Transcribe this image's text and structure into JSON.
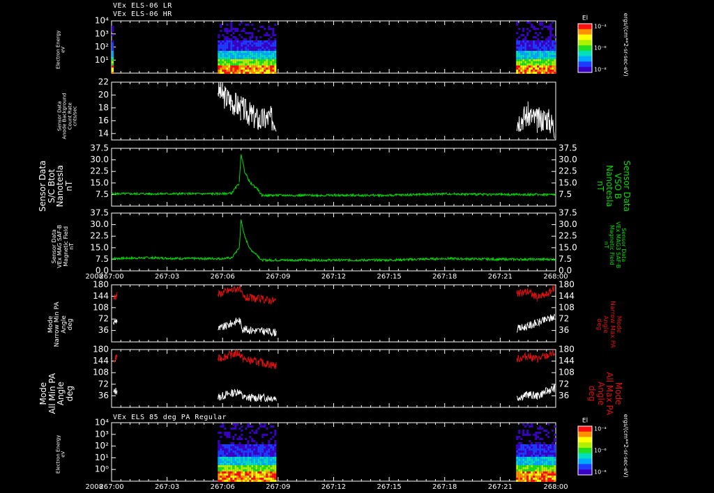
{
  "headers": {
    "top_line1": "VEx ELS-06 LR",
    "top_line2": "VEx ELS-06 HR",
    "bottom_line": "VEx ELS 85 deg PA Regular"
  },
  "colors": {
    "background": "#000000",
    "axis": "#ffffff",
    "trace_white": "#ffffff",
    "trace_green": "#00dd00",
    "trace_red": "#dd1111",
    "label_green": "#00dd00",
    "label_red": "#dd1111"
  },
  "colorbar": {
    "title": "El",
    "unit_label": "ergs/(cm**2-sr-sec-eV)",
    "tick_labels": [
      "10⁻⁴",
      "10⁻⁶",
      "10⁻⁸"
    ]
  },
  "time_axis": {
    "year_label": "2008",
    "tick_labels": [
      "267:00",
      "267:03",
      "267:06",
      "267:09",
      "267:12",
      "267:15",
      "267:18",
      "267:21",
      "268:00"
    ]
  },
  "panels": [
    {
      "id": "spectro1",
      "ylabel": [
        "Electron Energy",
        "eV"
      ],
      "ytick_labels": [
        "10⁴",
        "10³",
        "10²",
        "10¹"
      ]
    },
    {
      "id": "anode",
      "ylabel": [
        "Sensor Data",
        "Anode Background",
        "Count Rate",
        "cnts/sec"
      ],
      "ytick_labels": [
        "22",
        "20",
        "18",
        "16",
        "14"
      ]
    },
    {
      "id": "btot",
      "ylabel": [
        "Sensor Data",
        "S/C Btot",
        "Nanotesla",
        "nT"
      ],
      "ylabel_right": [
        "Sensor Data",
        "VSO B",
        "Nanotesla",
        "nT"
      ],
      "ytick_labels": [
        "37.5",
        "30.0",
        "22.5",
        "15.0",
        "7.5"
      ]
    },
    {
      "id": "mag",
      "ylabel": [
        "Sensor Data",
        "VEx MAG SAF-B",
        "Magnetic Field",
        "nT"
      ],
      "ylabel_right": [
        "Sensor Data",
        "VEx MAG3 SAF-B",
        "Magnetic Field",
        "nT"
      ],
      "ytick_labels": [
        "37.5",
        "30.0",
        "22.5",
        "15.0",
        "7.5",
        "0.0"
      ]
    },
    {
      "id": "pa_narrow",
      "ylabel": [
        "Mode",
        "Narrow Min PA",
        "Angle",
        "deg"
      ],
      "ylabel_right": [
        "Mode",
        "Narrow Max PA",
        "Angle",
        "deg"
      ],
      "ytick_labels": [
        "180",
        "144",
        "108",
        "72",
        "36"
      ]
    },
    {
      "id": "pa_all",
      "ylabel": [
        "Mode",
        "All Min PA",
        "Angle",
        "deg"
      ],
      "ylabel_right": [
        "Mode",
        "All Max PA",
        "Angle",
        "deg"
      ],
      "ytick_labels": [
        "180",
        "144",
        "108",
        "72",
        "36"
      ]
    },
    {
      "id": "spectro2",
      "ylabel": [
        "Electron Energy",
        "eV"
      ],
      "ytick_labels": [
        "10⁴",
        "10³",
        "10²",
        "10¹",
        "10⁰"
      ]
    }
  ],
  "chart_data": [
    {
      "type": "heatmap",
      "panel": "spectro1",
      "y_axis": "Electron Energy (eV)",
      "y_scale": "log",
      "ylim": [
        1,
        10000
      ],
      "data_intervals_hours": [
        [
          0.0,
          0.06
        ],
        [
          5.74,
          8.9
        ],
        [
          21.86,
          24.0
        ]
      ]
    },
    {
      "type": "line",
      "panel": "anode",
      "y_axis": "Anode Background Count Rate (cnts/sec)",
      "ylim": [
        13,
        22
      ],
      "series": [
        {
          "color": "#ffffff",
          "x_hours": [
            0.02,
            5.75,
            6.0,
            6.5,
            7.0,
            7.5,
            8.0,
            8.5,
            8.9,
            21.9,
            22.5,
            23.0,
            23.5,
            23.95
          ],
          "values": [
            16,
            21,
            20,
            19,
            18,
            17,
            16,
            16.5,
            16,
            16,
            17,
            16,
            16.5,
            15
          ]
        }
      ]
    },
    {
      "type": "line",
      "panel": "btot",
      "y_axis": "S/C Btot (nT)",
      "ylim": [
        0,
        37.5
      ],
      "series": [
        {
          "color": "#00dd00",
          "x_hours": [
            0,
            2,
            4,
            6,
            6.5,
            6.9,
            7.0,
            7.2,
            7.5,
            7.9,
            8.1,
            9,
            12,
            15,
            18,
            21,
            24
          ],
          "values": [
            8,
            8,
            8,
            8,
            8.5,
            15,
            34,
            22,
            15,
            11,
            7,
            7,
            7,
            7,
            8,
            7.5,
            7.5
          ]
        }
      ]
    },
    {
      "type": "line",
      "panel": "mag",
      "y_axis": "VEx MAG SAF-B Magnetic Field (nT)",
      "ylim": [
        0,
        37.5
      ],
      "series": [
        {
          "color": "#00dd00",
          "x_hours": [
            0,
            2,
            4,
            6,
            6.5,
            6.9,
            7.0,
            7.2,
            7.5,
            7.9,
            8.1,
            9,
            12,
            15,
            18,
            21,
            24
          ],
          "values": [
            8,
            8.5,
            8,
            8,
            8.5,
            15,
            33,
            22,
            14,
            10,
            7,
            7,
            7,
            7,
            8,
            7.5,
            7.5
          ]
        }
      ]
    },
    {
      "type": "line",
      "panel": "pa_narrow",
      "y_axis": "Narrow PA Angle (deg)",
      "ylim": [
        0,
        180
      ],
      "series": [
        {
          "name": "Narrow Min PA",
          "color": "#ffffff",
          "x_hours": [
            0.1,
            0.3,
            5.75,
            6.2,
            6.9,
            7.1,
            8.9,
            21.9,
            22.5,
            23.0,
            23.5,
            23.95
          ],
          "values": [
            60,
            70,
            40,
            50,
            70,
            40,
            30,
            40,
            50,
            60,
            70,
            80
          ]
        },
        {
          "name": "Narrow Max PA",
          "color": "#dd1111",
          "x_hours": [
            0.1,
            0.3,
            5.75,
            6.2,
            6.9,
            7.1,
            8.9,
            21.9,
            22.5,
            23.0,
            23.5,
            23.95
          ],
          "values": [
            140,
            150,
            150,
            160,
            170,
            140,
            130,
            150,
            160,
            140,
            150,
            170
          ]
        }
      ]
    },
    {
      "type": "line",
      "panel": "pa_all",
      "y_axis": "All PA Angle (deg)",
      "ylim": [
        0,
        180
      ],
      "series": [
        {
          "name": "All Min PA",
          "color": "#ffffff",
          "x_hours": [
            0.1,
            0.3,
            5.75,
            6.2,
            6.9,
            7.1,
            8.9,
            21.9,
            22.5,
            23.0,
            23.5,
            23.95
          ],
          "values": [
            45,
            55,
            30,
            40,
            50,
            30,
            30,
            30,
            40,
            35,
            50,
            60
          ]
        },
        {
          "name": "All Max PA",
          "color": "#dd1111",
          "x_hours": [
            0.1,
            0.3,
            5.75,
            6.2,
            6.9,
            7.1,
            8.9,
            21.9,
            22.5,
            23.0,
            23.5,
            23.95
          ],
          "values": [
            140,
            160,
            150,
            160,
            170,
            150,
            130,
            150,
            160,
            150,
            160,
            170
          ]
        }
      ]
    },
    {
      "type": "heatmap",
      "panel": "spectro2",
      "y_axis": "Electron Energy (eV)",
      "y_scale": "log",
      "ylim": [
        0.1,
        10000
      ],
      "data_intervals_hours": [
        [
          5.74,
          8.9
        ],
        [
          21.86,
          24.0
        ]
      ]
    }
  ]
}
